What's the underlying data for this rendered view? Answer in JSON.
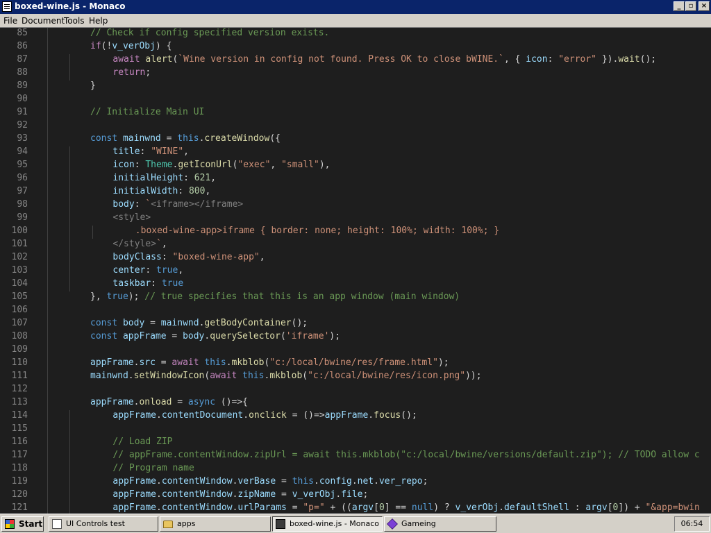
{
  "window": {
    "title": "boxed-wine.js - Monaco"
  },
  "menu": [
    "File",
    "Document",
    "Tools",
    "Help"
  ],
  "editor": {
    "lines": [
      {
        "n": "85",
        "ind": 1,
        "t": [
          [
            "cm",
            "// Check if config specified version exists."
          ]
        ]
      },
      {
        "n": "86",
        "ind": 1,
        "t": [
          [
            "ctl",
            "if"
          ],
          [
            "tx",
            "(!"
          ],
          [
            "vr",
            "v_verObj"
          ],
          [
            "tx",
            ") {"
          ]
        ]
      },
      {
        "n": "87",
        "ind": 2,
        "t": [
          [
            "ctl",
            "await "
          ],
          [
            "fn",
            "alert"
          ],
          [
            "tx",
            "("
          ],
          [
            "str",
            "`Wine version in config not found. Press OK to close bWINE.`"
          ],
          [
            "tx",
            ", { "
          ],
          [
            "vr",
            "icon"
          ],
          [
            "tx",
            ": "
          ],
          [
            "str",
            "\"error\""
          ],
          [
            "tx",
            " })."
          ],
          [
            "fn",
            "wait"
          ],
          [
            "tx",
            "();"
          ]
        ]
      },
      {
        "n": "88",
        "ind": 2,
        "t": [
          [
            "ctl",
            "return"
          ],
          [
            "tx",
            ";"
          ]
        ]
      },
      {
        "n": "89",
        "ind": 1,
        "t": [
          [
            "tx",
            "}"
          ]
        ]
      },
      {
        "n": "90",
        "ind": 1,
        "t": []
      },
      {
        "n": "91",
        "ind": 1,
        "t": [
          [
            "cm",
            "// Initialize Main UI"
          ]
        ]
      },
      {
        "n": "92",
        "ind": 1,
        "t": []
      },
      {
        "n": "93",
        "ind": 1,
        "t": [
          [
            "kw",
            "const "
          ],
          [
            "vr",
            "mainwnd"
          ],
          [
            "tx",
            " = "
          ],
          [
            "kw",
            "this"
          ],
          [
            "tx",
            "."
          ],
          [
            "fn",
            "createWindow"
          ],
          [
            "tx",
            "({"
          ]
        ]
      },
      {
        "n": "94",
        "ind": 2,
        "t": [
          [
            "vr",
            "title"
          ],
          [
            "tx",
            ": "
          ],
          [
            "str",
            "\"WINE\""
          ],
          [
            "tx",
            ","
          ]
        ]
      },
      {
        "n": "95",
        "ind": 2,
        "t": [
          [
            "vr",
            "icon"
          ],
          [
            "tx",
            ": "
          ],
          [
            "cls",
            "Theme"
          ],
          [
            "tx",
            "."
          ],
          [
            "fn",
            "getIconUrl"
          ],
          [
            "tx",
            "("
          ],
          [
            "str",
            "\"exec\""
          ],
          [
            "tx",
            ", "
          ],
          [
            "str",
            "\"small\""
          ],
          [
            "tx",
            "),"
          ]
        ]
      },
      {
        "n": "96",
        "ind": 2,
        "t": [
          [
            "vr",
            "initialHeight"
          ],
          [
            "tx",
            ": "
          ],
          [
            "num",
            "621"
          ],
          [
            "tx",
            ","
          ]
        ]
      },
      {
        "n": "97",
        "ind": 2,
        "t": [
          [
            "vr",
            "initialWidth"
          ],
          [
            "tx",
            ": "
          ],
          [
            "num",
            "800"
          ],
          [
            "tx",
            ","
          ]
        ]
      },
      {
        "n": "98",
        "ind": 2,
        "t": [
          [
            "vr",
            "body"
          ],
          [
            "tx",
            ": "
          ],
          [
            "str",
            "`"
          ],
          [
            "tg",
            "<iframe></iframe>"
          ]
        ]
      },
      {
        "n": "99",
        "ind": 2,
        "t": [
          [
            "tg",
            "<style>"
          ]
        ]
      },
      {
        "n": "100",
        "ind": 3,
        "t": [
          [
            "str",
            ".boxed-wine-app>iframe { border: none; height: 100%; width: 100%; }"
          ]
        ]
      },
      {
        "n": "101",
        "ind": 2,
        "t": [
          [
            "tg",
            "</style>"
          ],
          [
            "str",
            "`"
          ],
          [
            "tx",
            ","
          ]
        ]
      },
      {
        "n": "102",
        "ind": 2,
        "t": [
          [
            "vr",
            "bodyClass"
          ],
          [
            "tx",
            ": "
          ],
          [
            "str",
            "\"boxed-wine-app\""
          ],
          [
            "tx",
            ","
          ]
        ]
      },
      {
        "n": "103",
        "ind": 2,
        "t": [
          [
            "vr",
            "center"
          ],
          [
            "tx",
            ": "
          ],
          [
            "kw",
            "true"
          ],
          [
            "tx",
            ","
          ]
        ]
      },
      {
        "n": "104",
        "ind": 2,
        "t": [
          [
            "vr",
            "taskbar"
          ],
          [
            "tx",
            ": "
          ],
          [
            "kw",
            "true"
          ]
        ]
      },
      {
        "n": "105",
        "ind": 1,
        "t": [
          [
            "tx",
            "}, "
          ],
          [
            "kw",
            "true"
          ],
          [
            "tx",
            "); "
          ],
          [
            "cm",
            "// true specifies that this is an app window (main window)"
          ]
        ]
      },
      {
        "n": "106",
        "ind": 1,
        "t": []
      },
      {
        "n": "107",
        "ind": 1,
        "t": [
          [
            "kw",
            "const "
          ],
          [
            "vr",
            "body"
          ],
          [
            "tx",
            " = "
          ],
          [
            "vr",
            "mainwnd"
          ],
          [
            "tx",
            "."
          ],
          [
            "fn",
            "getBodyContainer"
          ],
          [
            "tx",
            "();"
          ]
        ]
      },
      {
        "n": "108",
        "ind": 1,
        "t": [
          [
            "kw",
            "const "
          ],
          [
            "vr",
            "appFrame"
          ],
          [
            "tx",
            " = "
          ],
          [
            "vr",
            "body"
          ],
          [
            "tx",
            "."
          ],
          [
            "fn",
            "querySelector"
          ],
          [
            "tx",
            "("
          ],
          [
            "str",
            "'iframe'"
          ],
          [
            "tx",
            ");"
          ]
        ]
      },
      {
        "n": "109",
        "ind": 1,
        "t": []
      },
      {
        "n": "110",
        "ind": 1,
        "t": [
          [
            "vr",
            "appFrame"
          ],
          [
            "tx",
            "."
          ],
          [
            "vr",
            "src"
          ],
          [
            "tx",
            " = "
          ],
          [
            "ctl",
            "await "
          ],
          [
            "kw",
            "this"
          ],
          [
            "tx",
            "."
          ],
          [
            "fn",
            "mkblob"
          ],
          [
            "tx",
            "("
          ],
          [
            "str",
            "\"c:/local/bwine/res/frame.html\""
          ],
          [
            "tx",
            ");"
          ]
        ]
      },
      {
        "n": "111",
        "ind": 1,
        "t": [
          [
            "vr",
            "mainwnd"
          ],
          [
            "tx",
            "."
          ],
          [
            "fn",
            "setWindowIcon"
          ],
          [
            "tx",
            "("
          ],
          [
            "ctl",
            "await "
          ],
          [
            "kw",
            "this"
          ],
          [
            "tx",
            "."
          ],
          [
            "fn",
            "mkblob"
          ],
          [
            "tx",
            "("
          ],
          [
            "str",
            "\"c:/local/bwine/res/icon.png\""
          ],
          [
            "tx",
            "));"
          ]
        ]
      },
      {
        "n": "112",
        "ind": 1,
        "t": []
      },
      {
        "n": "113",
        "ind": 1,
        "t": [
          [
            "vr",
            "appFrame"
          ],
          [
            "tx",
            "."
          ],
          [
            "fn",
            "onload"
          ],
          [
            "tx",
            " = "
          ],
          [
            "kw",
            "async "
          ],
          [
            "tx",
            "()=>{"
          ]
        ]
      },
      {
        "n": "114",
        "ind": 2,
        "t": [
          [
            "vr",
            "appFrame"
          ],
          [
            "tx",
            "."
          ],
          [
            "vr",
            "contentDocument"
          ],
          [
            "tx",
            "."
          ],
          [
            "fn",
            "onclick"
          ],
          [
            "tx",
            " = ()=>"
          ],
          [
            "vr",
            "appFrame"
          ],
          [
            "tx",
            "."
          ],
          [
            "fn",
            "focus"
          ],
          [
            "tx",
            "();"
          ]
        ]
      },
      {
        "n": "115",
        "ind": 2,
        "t": []
      },
      {
        "n": "116",
        "ind": 2,
        "t": [
          [
            "cm",
            "// Load ZIP"
          ]
        ]
      },
      {
        "n": "117",
        "ind": 2,
        "t": [
          [
            "cm",
            "// appFrame.contentWindow.zipUrl = await this.mkblob(\"c:/local/bwine/versions/default.zip\"); // TODO allow c"
          ]
        ]
      },
      {
        "n": "118",
        "ind": 2,
        "t": [
          [
            "cm",
            "// Program name"
          ]
        ]
      },
      {
        "n": "119",
        "ind": 2,
        "t": [
          [
            "vr",
            "appFrame"
          ],
          [
            "tx",
            "."
          ],
          [
            "vr",
            "contentWindow"
          ],
          [
            "tx",
            "."
          ],
          [
            "vr",
            "verBase"
          ],
          [
            "tx",
            " = "
          ],
          [
            "kw",
            "this"
          ],
          [
            "tx",
            "."
          ],
          [
            "vr",
            "config"
          ],
          [
            "tx",
            "."
          ],
          [
            "vr",
            "net"
          ],
          [
            "tx",
            "."
          ],
          [
            "vr",
            "ver_repo"
          ],
          [
            "tx",
            ";"
          ]
        ]
      },
      {
        "n": "120",
        "ind": 2,
        "t": [
          [
            "vr",
            "appFrame"
          ],
          [
            "tx",
            "."
          ],
          [
            "vr",
            "contentWindow"
          ],
          [
            "tx",
            "."
          ],
          [
            "vr",
            "zipName"
          ],
          [
            "tx",
            " = "
          ],
          [
            "vr",
            "v_verObj"
          ],
          [
            "tx",
            "."
          ],
          [
            "vr",
            "file"
          ],
          [
            "tx",
            ";"
          ]
        ]
      },
      {
        "n": "121",
        "ind": 2,
        "t": [
          [
            "vr",
            "appFrame"
          ],
          [
            "tx",
            "."
          ],
          [
            "vr",
            "contentWindow"
          ],
          [
            "tx",
            "."
          ],
          [
            "vr",
            "urlParams"
          ],
          [
            "tx",
            " = "
          ],
          [
            "str",
            "\"p=\""
          ],
          [
            "tx",
            " + (("
          ],
          [
            "vr",
            "argv"
          ],
          [
            "tx",
            "["
          ],
          [
            "num",
            "0"
          ],
          [
            "tx",
            "] == "
          ],
          [
            "kw",
            "null"
          ],
          [
            "tx",
            ") ? "
          ],
          [
            "vr",
            "v_verObj"
          ],
          [
            "tx",
            "."
          ],
          [
            "vr",
            "defaultShell"
          ],
          [
            "tx",
            " : "
          ],
          [
            "vr",
            "argv"
          ],
          [
            "tx",
            "["
          ],
          [
            "num",
            "0"
          ],
          [
            "tx",
            "]) + "
          ],
          [
            "str",
            "\"&app=bwin"
          ]
        ]
      }
    ]
  },
  "taskbar": {
    "start": "Start",
    "items": [
      {
        "label": "UI Controls test",
        "icon": "doc",
        "active": false
      },
      {
        "label": "apps",
        "icon": "folder",
        "active": false
      },
      {
        "label": "boxed-wine.js - Monaco",
        "icon": "monaco",
        "active": true
      },
      {
        "label": "Gameing",
        "icon": "cube",
        "active": false
      }
    ],
    "clock": "06:54"
  }
}
